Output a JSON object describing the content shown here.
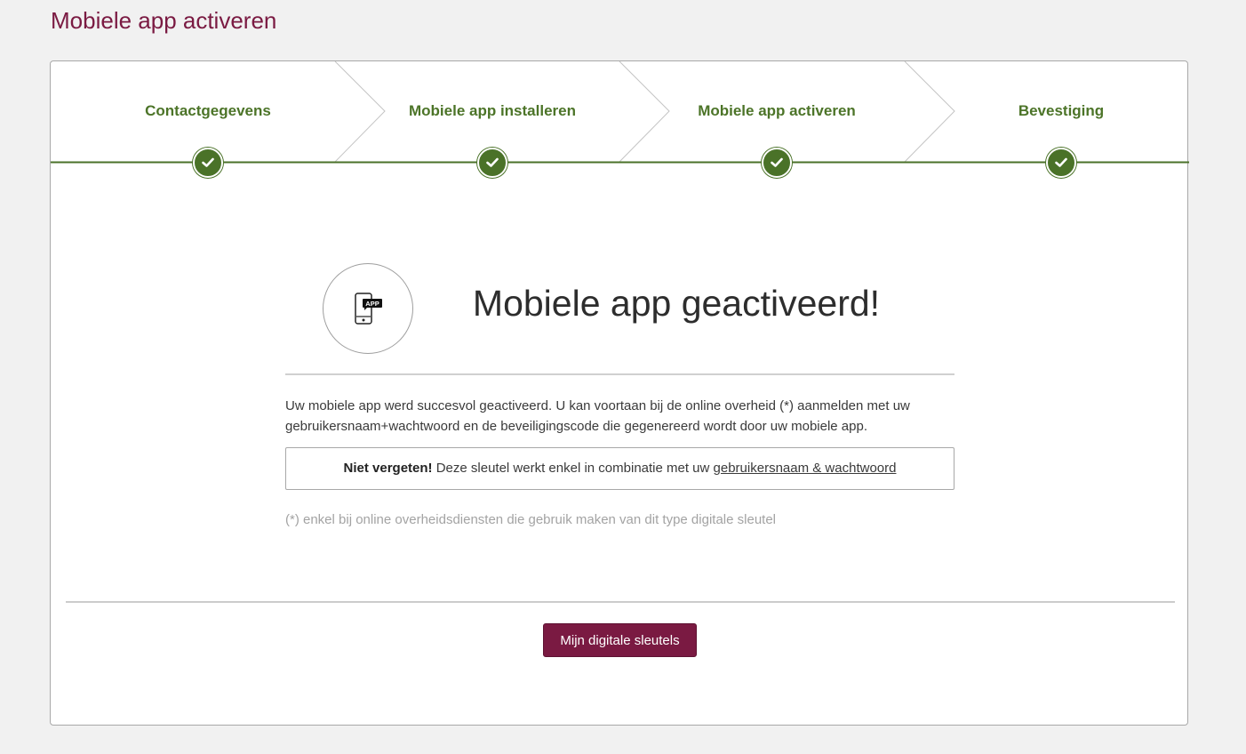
{
  "page": {
    "title": "Mobiele app activeren"
  },
  "steps": [
    {
      "label": "Contactgegevens",
      "completed": true
    },
    {
      "label": "Mobiele app installeren",
      "completed": true
    },
    {
      "label": "Mobiele app activeren",
      "completed": true
    },
    {
      "label": "Bevestiging",
      "completed": true
    }
  ],
  "result": {
    "icon": "mobile-app-icon",
    "icon_badge": "APP",
    "title": "Mobiele app geactiveerd!",
    "description": "Uw mobiele app werd succesvol geactiveerd. U kan voortaan bij de online overheid (*) aanmelden met uw gebruikersnaam+wachtwoord en de beveiligingscode die gegenereerd wordt door uw mobiele app.",
    "reminder": {
      "strong": "Niet vergeten!",
      "text": "Deze sleutel werkt enkel in combinatie met uw",
      "link": "gebruikersnaam & wachtwoord"
    },
    "footnote": "(*) enkel bij online overheidsdiensten die gebruik maken van dit type digitale sleutel"
  },
  "actions": {
    "primary_label": "Mijn digitale sleutels"
  },
  "colors": {
    "accent": "#7a1a42",
    "step_green": "#4a7228",
    "text": "#333333",
    "muted": "#a3a3a3"
  }
}
